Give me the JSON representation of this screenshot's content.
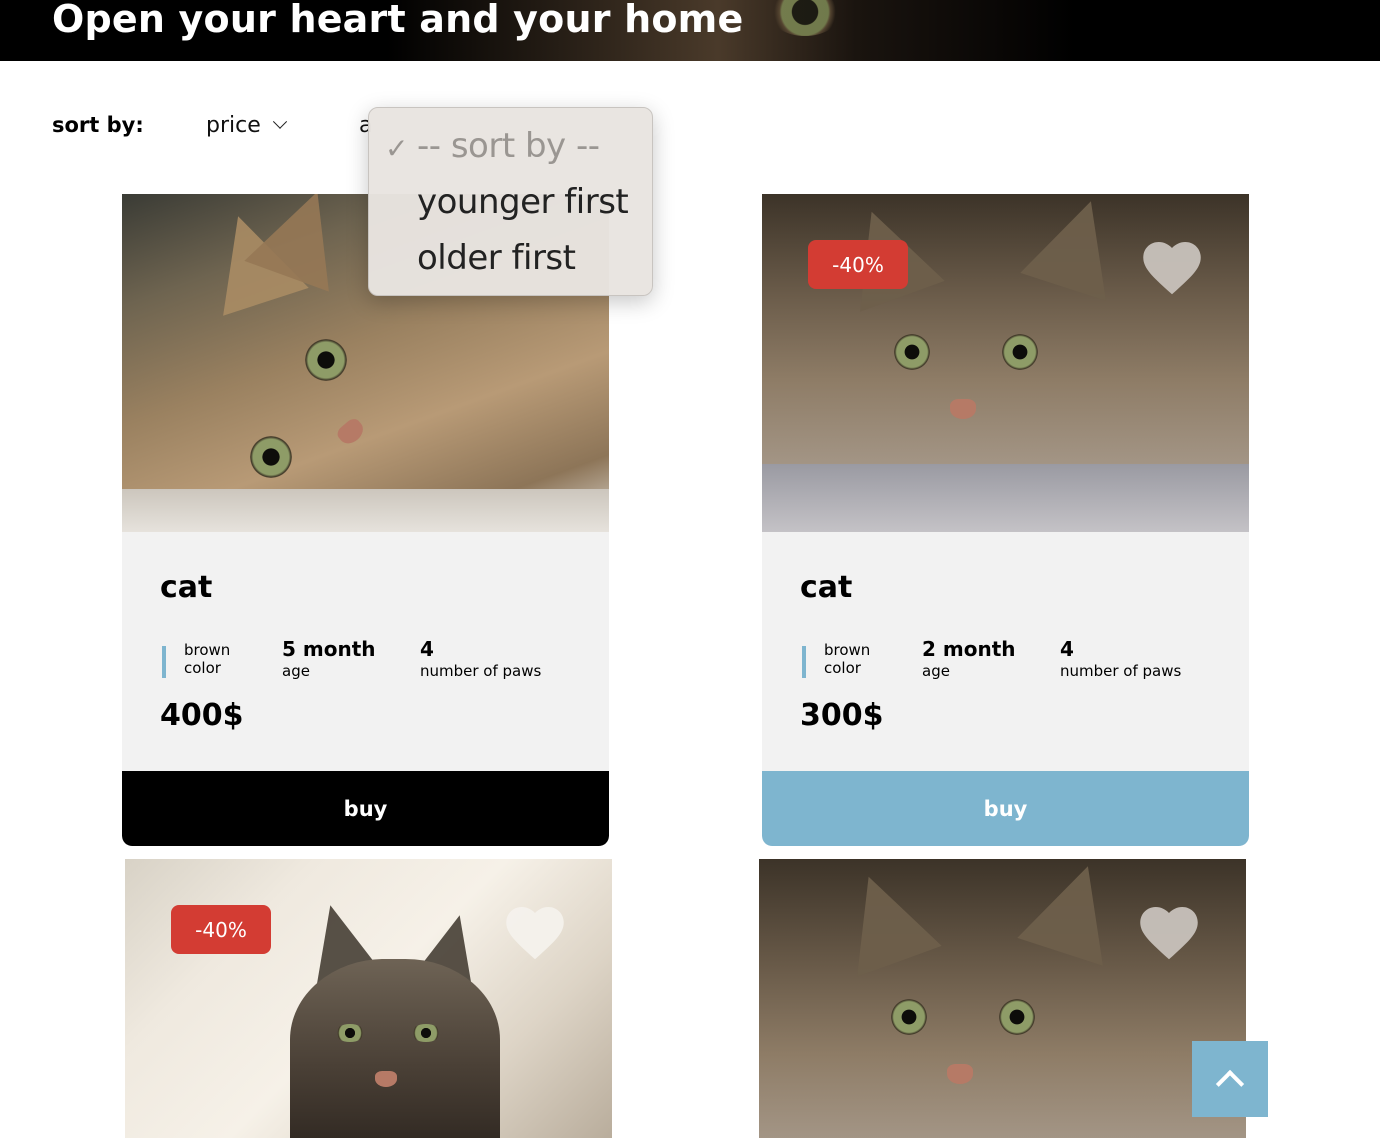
{
  "header": {
    "title": "Open your heart and your home"
  },
  "sort": {
    "label": "sort by:",
    "price_select": "price",
    "age_select_partial": "a",
    "dropdown_options": [
      {
        "label": "-- sort by --",
        "selected": true,
        "disabled": true
      },
      {
        "label": "younger first",
        "selected": false,
        "disabled": false
      },
      {
        "label": "older first",
        "selected": false,
        "disabled": false
      }
    ]
  },
  "cards": [
    {
      "name": "cat",
      "color_value": "brown",
      "color_label": "color",
      "age_value": "5 month",
      "age_label": "age",
      "paws_value": "4",
      "paws_label": "number of paws",
      "price": "400$",
      "buy_label": "buy",
      "buy_color": "#000000"
    },
    {
      "name": "cat",
      "color_value": "brown",
      "color_label": "color",
      "age_value": "2 month",
      "age_label": "age",
      "paws_value": "4",
      "paws_label": "number of paws",
      "price": "300$",
      "buy_label": "buy",
      "buy_color": "#7eb5cf",
      "discount": "-40%"
    },
    {
      "discount": "-40%"
    },
    {}
  ],
  "colors": {
    "accent": "#7eb5cf",
    "discount": "#d33c33",
    "card_bg": "#f2f2f2"
  },
  "icons": {
    "favorite": "heart-icon",
    "dropdown": "chevron-down-icon",
    "check": "checkmark-icon",
    "scroll_top": "chevron-up-icon"
  }
}
